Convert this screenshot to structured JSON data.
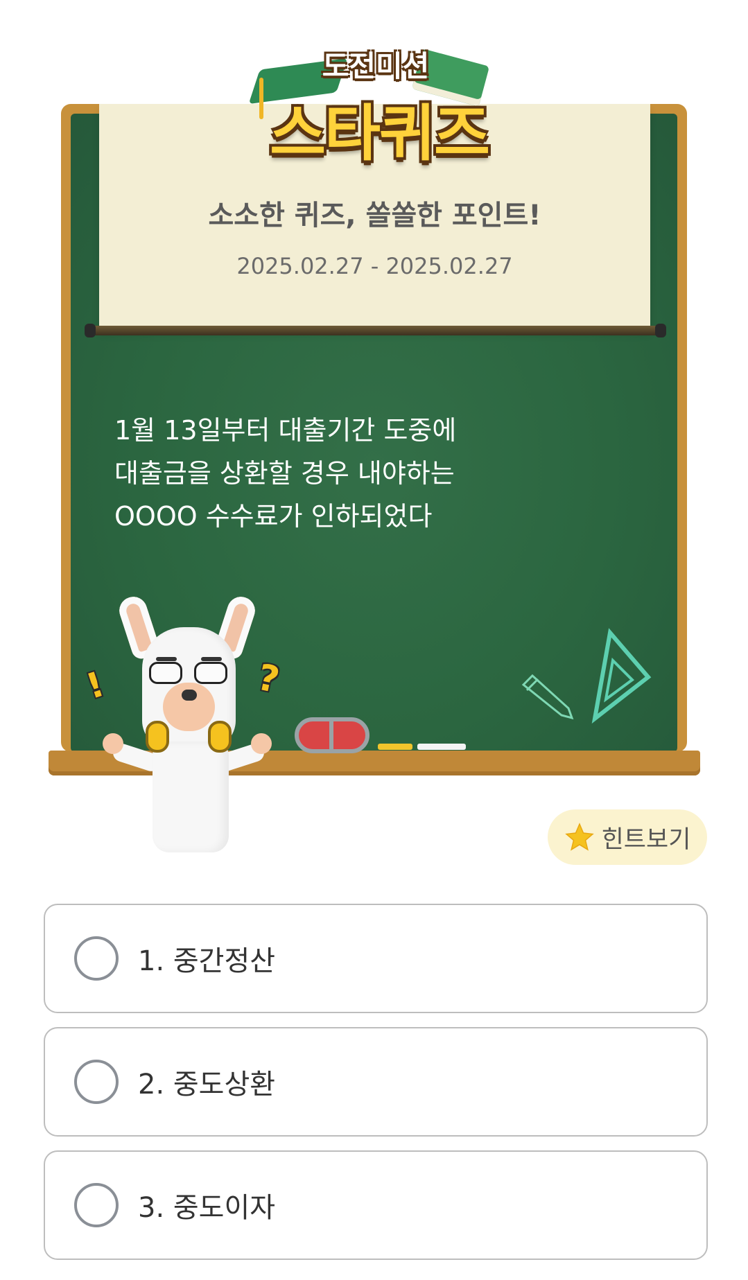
{
  "header": {
    "logo_small": "도전미션",
    "logo_main": "스타퀴즈"
  },
  "banner": {
    "subtitle": "소소한 퀴즈, 쏠쏠한 포인트!",
    "date_range": "2025.02.27 - 2025.02.27"
  },
  "question": {
    "lines": [
      "1월 13일부터 대출기간 도중에",
      "대출금을 상환할 경우 내야하는",
      "OOOO 수수료가 인하되었다"
    ]
  },
  "hint": {
    "label": "힌트보기",
    "icon": "star-icon"
  },
  "options": [
    {
      "label": "1. 중간정산"
    },
    {
      "label": "2. 중도상환"
    },
    {
      "label": "3. 중도이자"
    }
  ],
  "colors": {
    "board": "#2b6640",
    "frame": "#c8913b",
    "scroll": "#f3eed4",
    "hint_bg": "#fbf3cf"
  }
}
